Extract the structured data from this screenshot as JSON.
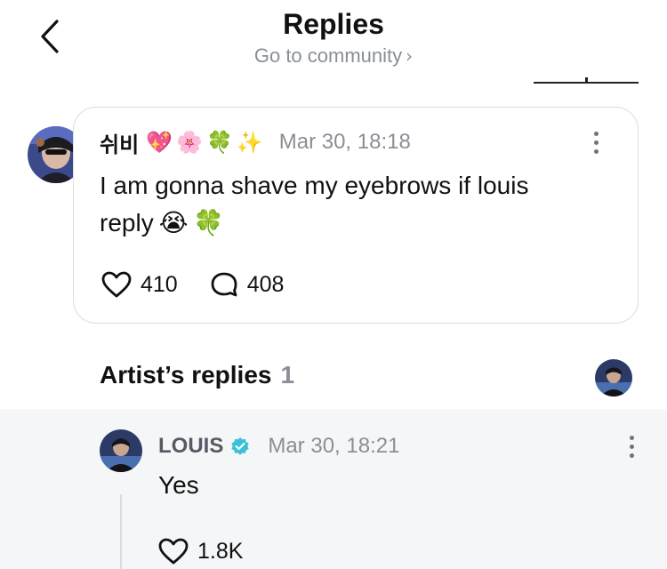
{
  "header": {
    "title": "Replies",
    "community_link": "Go to community",
    "chevron": "›"
  },
  "post": {
    "username": "쉬비",
    "badges": [
      "💖",
      "🌸",
      "🍀",
      "✨"
    ],
    "timestamp": "Mar 30, 18:18",
    "text": "I am gonna shave my eyebrows if louis reply",
    "text_emojis": [
      "😭",
      "🍀"
    ],
    "likes": "410",
    "comments": "408"
  },
  "artist_section": {
    "title": "Artist’s replies",
    "count": "1"
  },
  "reply": {
    "username": "LOUIS",
    "verified": true,
    "timestamp": "Mar 30, 18:21",
    "text": "Yes",
    "likes": "1.8K"
  },
  "icons": {
    "back": "chevron-left-icon",
    "more": "more-vertical-icon",
    "like": "heart-icon",
    "comment": "speech-bubble-icon",
    "verified": "verified-badge-icon"
  },
  "colors": {
    "muted_text": "#8a8f96",
    "verified_badge": "#39c2d7",
    "reply_panel_bg": "#f5f6f8"
  }
}
